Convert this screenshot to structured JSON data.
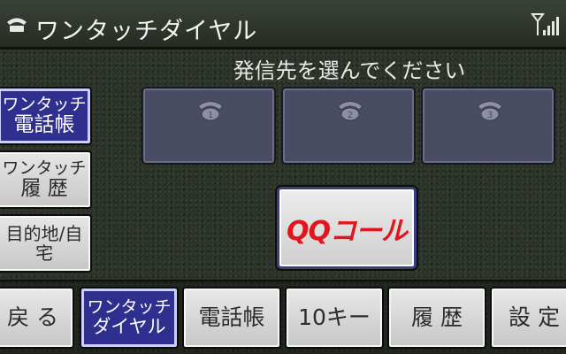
{
  "header": {
    "title": "ワンタッチダイヤル",
    "phone_icon": "phone-icon",
    "signal_icon": "antenna-signal-icon"
  },
  "instruction": "発信先を選んでください",
  "sidebar": {
    "items": [
      {
        "line1": "ワンタッチ",
        "line2": "電話帳",
        "active": true
      },
      {
        "line1": "ワンタッチ",
        "line2": "履 歴",
        "active": false
      },
      {
        "label": "目的地/自宅",
        "active": false
      }
    ]
  },
  "slots": [
    {
      "number": "1",
      "icon": "phone-1-icon"
    },
    {
      "number": "2",
      "icon": "phone-2-icon"
    },
    {
      "number": "3",
      "icon": "phone-3-icon"
    }
  ],
  "qq_call": {
    "label": "QQコール",
    "color": "#e3141c"
  },
  "bottom": {
    "back": "戻 る",
    "one_touch_line1": "ワンタッチ",
    "one_touch_line2": "ダイヤル",
    "phonebook": "電話帳",
    "ten_key": "10キー",
    "history": "履 歴",
    "settings": "設 定"
  },
  "colors": {
    "active_button": "#2f2f8f",
    "slot_background": "#4a4c64",
    "background": "#2b3328"
  }
}
